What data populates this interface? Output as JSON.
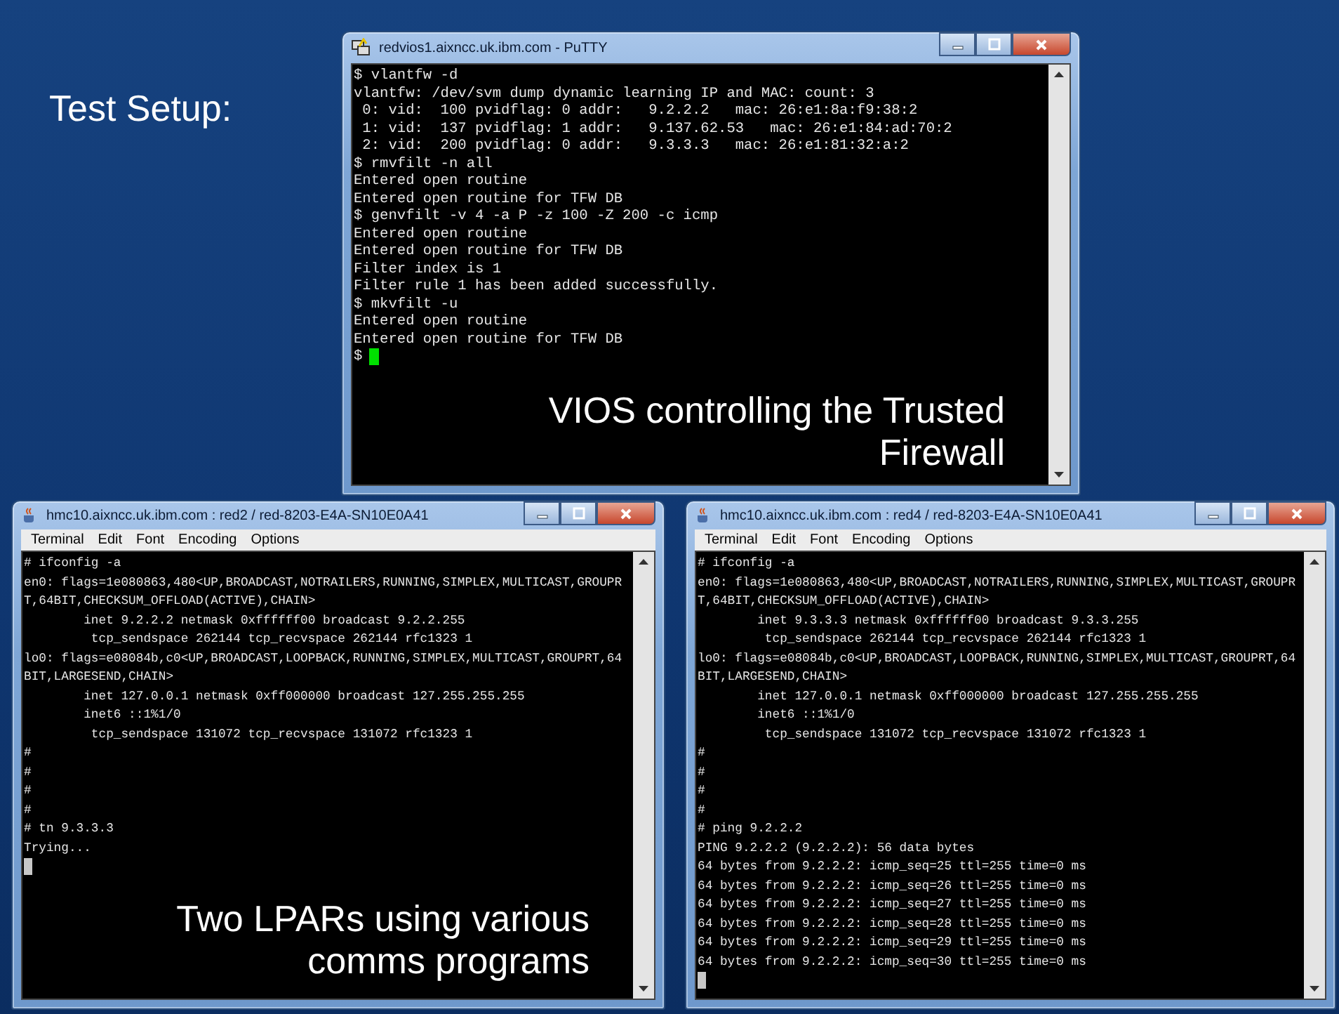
{
  "slide_title": "Test Setup:",
  "windows": [
    {
      "kind": "putty",
      "title": "redvios1.aixncc.uk.ibm.com - PuTTY",
      "lines": [
        "$ vlantfw -d",
        "vlantfw: /dev/svm dump dynamic learning IP and MAC: count: 3",
        " 0: vid:  100 pvidflag: 0 addr:   9.2.2.2   mac: 26:e1:8a:f9:38:2",
        " 1: vid:  137 pvidflag: 1 addr:   9.137.62.53   mac: 26:e1:84:ad:70:2",
        " 2: vid:  200 pvidflag: 0 addr:   9.3.3.3   mac: 26:e1:81:32:a:2",
        "$ rmvfilt -n all",
        "Entered open routine",
        "Entered open routine for TFW DB",
        "$ genvfilt -v 4 -a P -z 100 -Z 200 -c icmp",
        "Entered open routine",
        "Entered open routine for TFW DB",
        "Filter index is 1",
        "Filter rule 1 has been added successfully.",
        "$ mkvfilt -u",
        "Entered open routine",
        "Entered open routine for TFW DB"
      ],
      "prompt": "$",
      "caption": "VIOS controlling the Trusted Firewall"
    },
    {
      "kind": "java",
      "title": "hmc10.aixncc.uk.ibm.com : red2 / red-8203-E4A-SN10E0A41",
      "menu": [
        "Terminal",
        "Edit",
        "Font",
        "Encoding",
        "Options"
      ],
      "lines": [
        "# ifconfig -a",
        "en0: flags=1e080863,480<UP,BROADCAST,NOTRAILERS,RUNNING,SIMPLEX,MULTICAST,GROUPR",
        "T,64BIT,CHECKSUM_OFFLOAD(ACTIVE),CHAIN>",
        "        inet 9.2.2.2 netmask 0xffffff00 broadcast 9.2.2.255",
        "         tcp_sendspace 262144 tcp_recvspace 262144 rfc1323 1",
        "lo0: flags=e08084b,c0<UP,BROADCAST,LOOPBACK,RUNNING,SIMPLEX,MULTICAST,GROUPRT,64",
        "BIT,LARGESEND,CHAIN>",
        "        inet 127.0.0.1 netmask 0xff000000 broadcast 127.255.255.255",
        "        inet6 ::1%1/0",
        "         tcp_sendspace 131072 tcp_recvspace 131072 rfc1323 1",
        "#",
        "#",
        "#",
        "#",
        "# tn 9.3.3.3",
        "Trying..."
      ],
      "caption": "Two LPARs using various comms programs"
    },
    {
      "kind": "java",
      "title": "hmc10.aixncc.uk.ibm.com : red4 / red-8203-E4A-SN10E0A41",
      "menu": [
        "Terminal",
        "Edit",
        "Font",
        "Encoding",
        "Options"
      ],
      "lines": [
        "# ifconfig -a",
        "en0: flags=1e080863,480<UP,BROADCAST,NOTRAILERS,RUNNING,SIMPLEX,MULTICAST,GROUPR",
        "T,64BIT,CHECKSUM_OFFLOAD(ACTIVE),CHAIN>",
        "        inet 9.3.3.3 netmask 0xffffff00 broadcast 9.3.3.255",
        "         tcp_sendspace 262144 tcp_recvspace 262144 rfc1323 1",
        "lo0: flags=e08084b,c0<UP,BROADCAST,LOOPBACK,RUNNING,SIMPLEX,MULTICAST,GROUPRT,64",
        "BIT,LARGESEND,CHAIN>",
        "        inet 127.0.0.1 netmask 0xff000000 broadcast 127.255.255.255",
        "        inet6 ::1%1/0",
        "         tcp_sendspace 131072 tcp_recvspace 131072 rfc1323 1",
        "#",
        "#",
        "#",
        "#",
        "# ping 9.2.2.2",
        "PING 9.2.2.2 (9.2.2.2): 56 data bytes",
        "64 bytes from 9.2.2.2: icmp_seq=25 ttl=255 time=0 ms",
        "64 bytes from 9.2.2.2: icmp_seq=26 ttl=255 time=0 ms",
        "64 bytes from 9.2.2.2: icmp_seq=27 ttl=255 time=0 ms",
        "64 bytes from 9.2.2.2: icmp_seq=28 ttl=255 time=0 ms",
        "64 bytes from 9.2.2.2: icmp_seq=29 ttl=255 time=0 ms",
        "64 bytes from 9.2.2.2: icmp_seq=30 ttl=255 time=0 ms"
      ]
    }
  ]
}
